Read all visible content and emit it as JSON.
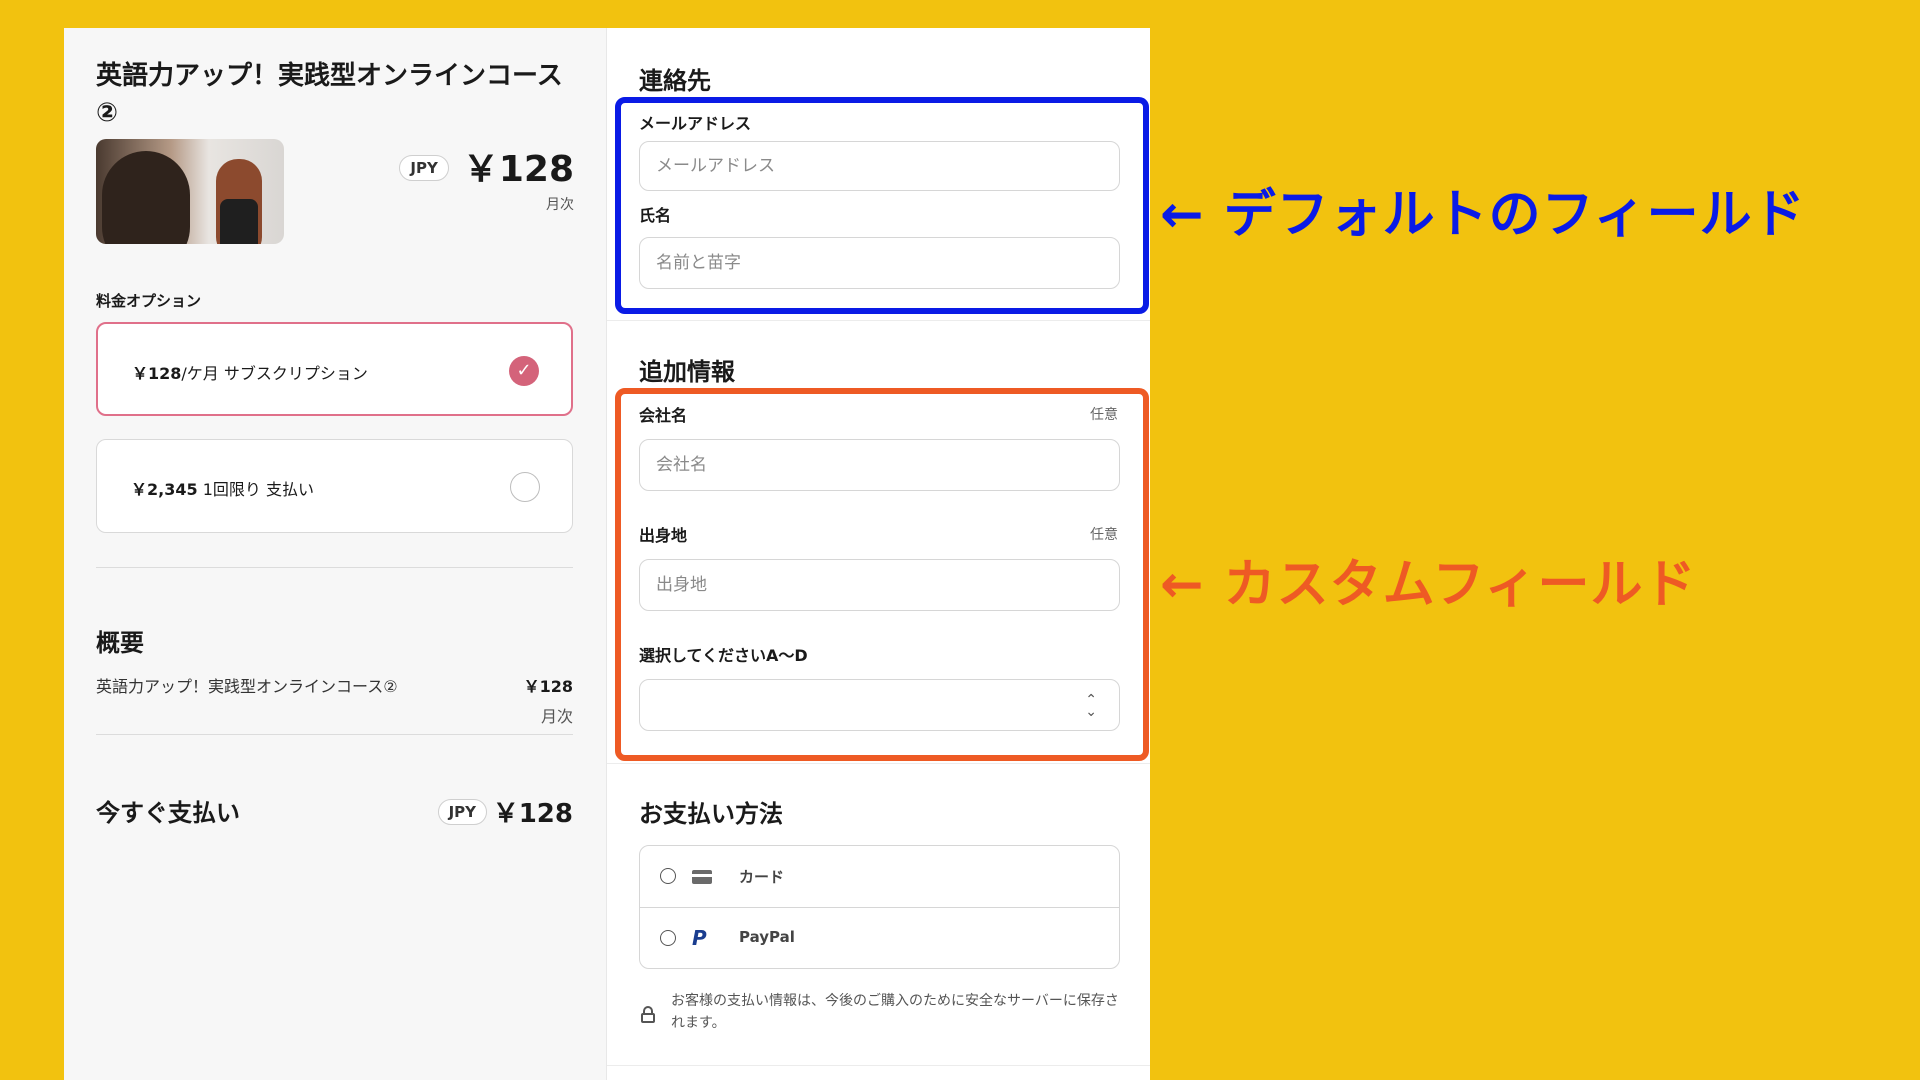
{
  "product": {
    "title": "英語力アップ！実践型オンラインコース②",
    "currency": "JPY",
    "price": "￥128",
    "period": "月次"
  },
  "pricing": {
    "label": "料金オプション",
    "options": [
      {
        "amount": "￥128",
        "rest": "/ケ月 サブスクリプション",
        "selected": true
      },
      {
        "amount": "￥2,345",
        "rest": " 1回限り 支払い",
        "selected": false
      }
    ]
  },
  "summary": {
    "title": "概要",
    "item_name": "英語力アップ！実践型オンラインコース②",
    "item_price": "￥128",
    "item_period": "月次"
  },
  "paynow": {
    "label": "今すぐ支払い",
    "currency": "JPY",
    "amount": "￥128"
  },
  "contact": {
    "title": "連絡先",
    "email_label": "メールアドレス",
    "email_placeholder": "メールアドレス",
    "name_label": "氏名",
    "name_placeholder": "名前と苗字"
  },
  "extra": {
    "title": "追加情報",
    "company_label": "会社名",
    "company_optional": "任意",
    "company_placeholder": "会社名",
    "hometown_label": "出身地",
    "hometown_optional": "任意",
    "hometown_placeholder": "出身地",
    "select_label": "選択してくださいA〜D",
    "select_value": ""
  },
  "payment": {
    "title": "お支払い方法",
    "methods": [
      {
        "label": "カード",
        "icon": "credit-card-icon"
      },
      {
        "label": "PayPal",
        "icon": "paypal-icon"
      }
    ],
    "secure_note": "お客様の支払い情報は、今後のご購入のために安全なサーバーに保存されます。"
  },
  "annotations": {
    "default_fields": "← デフォルトのフィールド",
    "custom_fields": "← カスタムフィールド",
    "default_color": "#0a1be6",
    "custom_color": "#ee5a24"
  },
  "colors": {
    "background": "#F2C20F",
    "accent_selected": "#d4637a"
  }
}
